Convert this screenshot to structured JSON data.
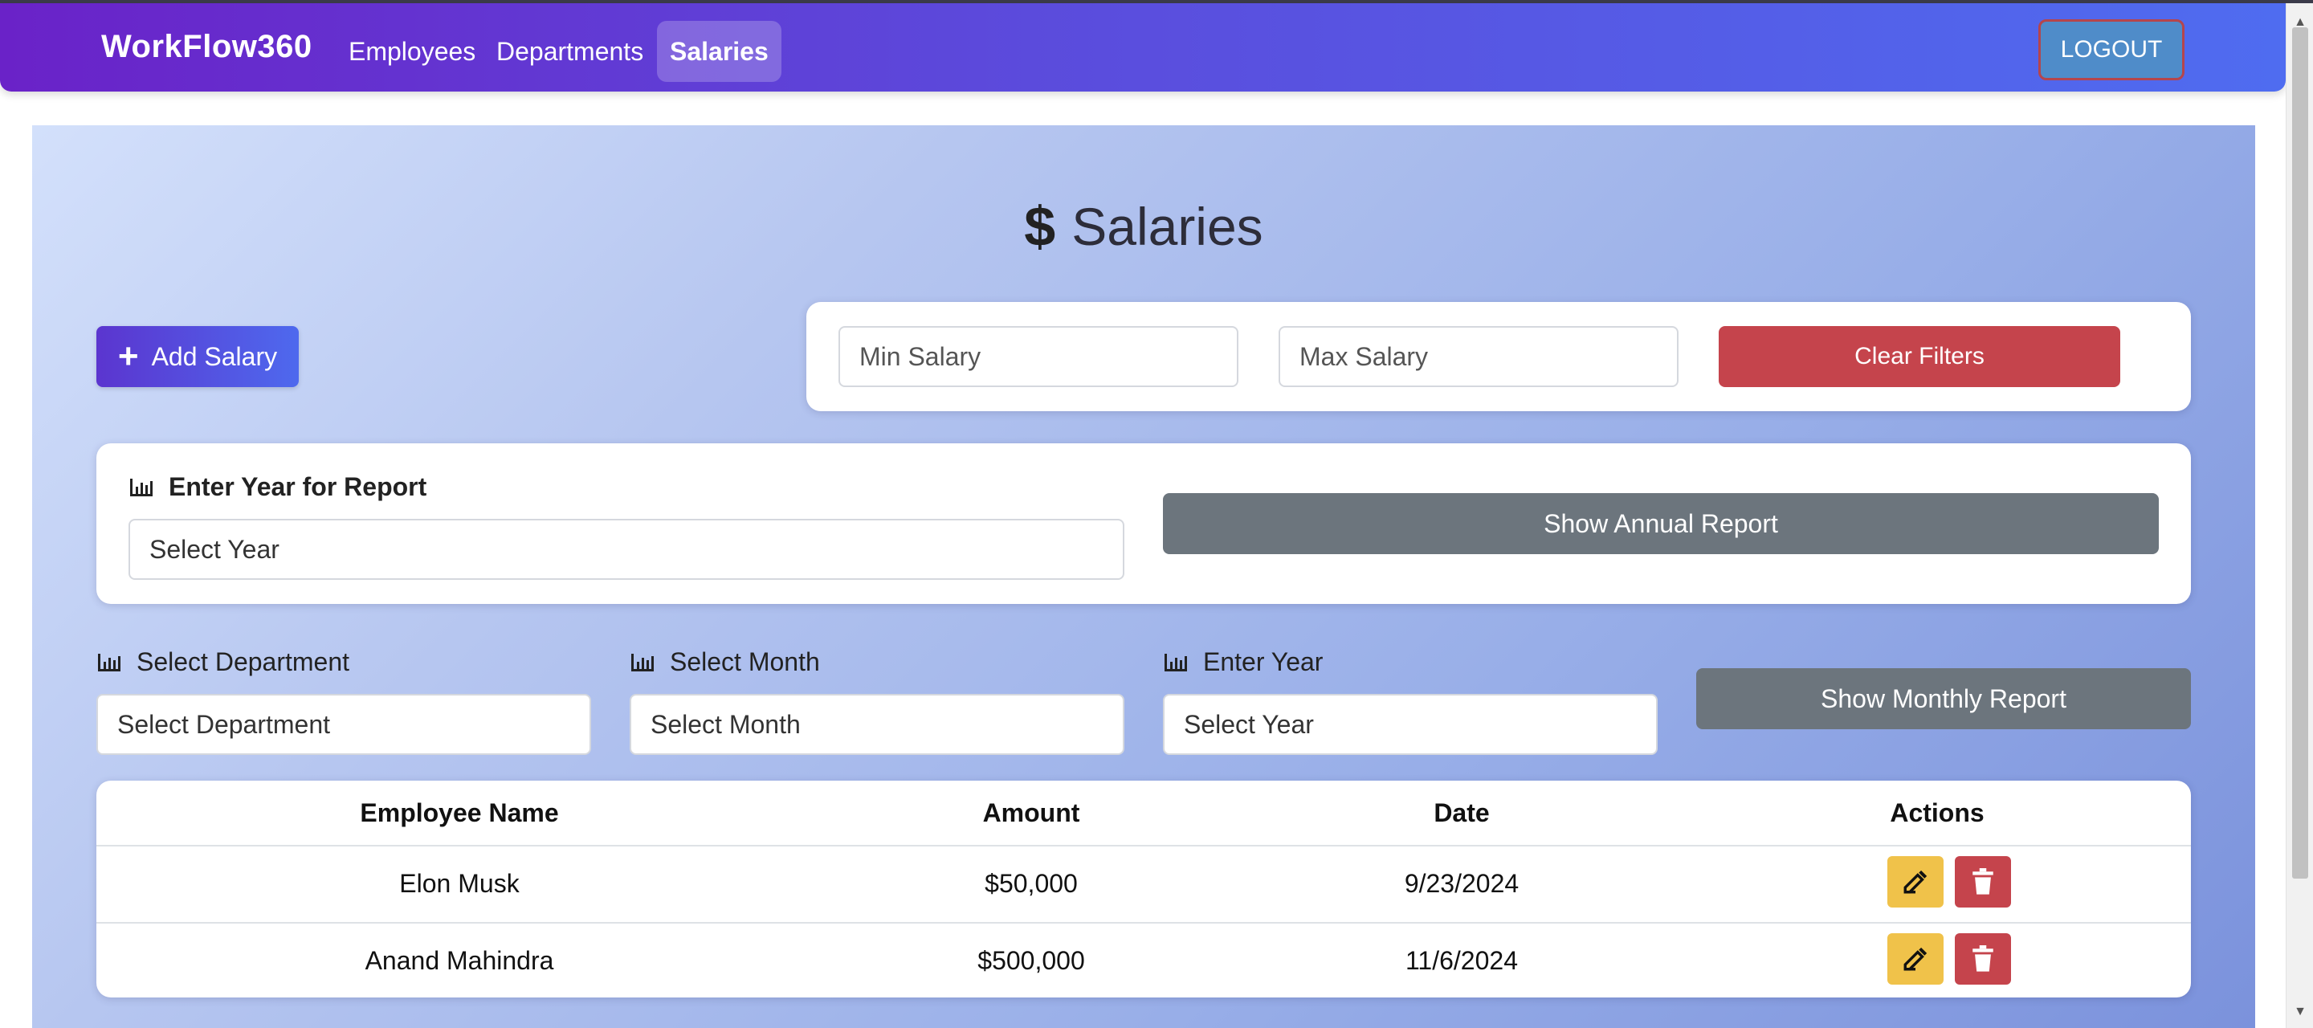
{
  "navbar": {
    "brand": "WorkFlow360",
    "links": [
      {
        "label": "Employees",
        "active": false
      },
      {
        "label": "Departments",
        "active": false
      },
      {
        "label": "Salaries",
        "active": true
      }
    ],
    "logout_label": "LOGOUT"
  },
  "page": {
    "title": "Salaries",
    "title_icon": "dollar-icon"
  },
  "toolbar": {
    "add_label": "Add Salary",
    "min_salary_placeholder": "Min Salary",
    "max_salary_placeholder": "Max Salary",
    "clear_filters_label": "Clear Filters"
  },
  "annual_report": {
    "label": "Enter Year for Report",
    "year_select_value": "Select Year",
    "button_label": "Show Annual Report"
  },
  "monthly_report": {
    "department_label": "Select Department",
    "department_value": "Select Department",
    "month_label": "Select Month",
    "month_value": "Select Month",
    "year_label": "Enter Year",
    "year_value": "Select Year",
    "button_label": "Show Monthly Report"
  },
  "table": {
    "headers": [
      "Employee Name",
      "Amount",
      "Date",
      "Actions"
    ],
    "rows": [
      {
        "name": "Elon Musk",
        "amount": "$50,000",
        "date": "9/23/2024"
      },
      {
        "name": "Anand Mahindra",
        "amount": "$500,000",
        "date": "11/6/2024"
      }
    ]
  },
  "colors": {
    "nav_gradient_start": "#6a22c8",
    "nav_gradient_end": "#4f6cf0",
    "danger": "#c5444c",
    "warning": "#f0c24a",
    "secondary": "#6c757d"
  }
}
